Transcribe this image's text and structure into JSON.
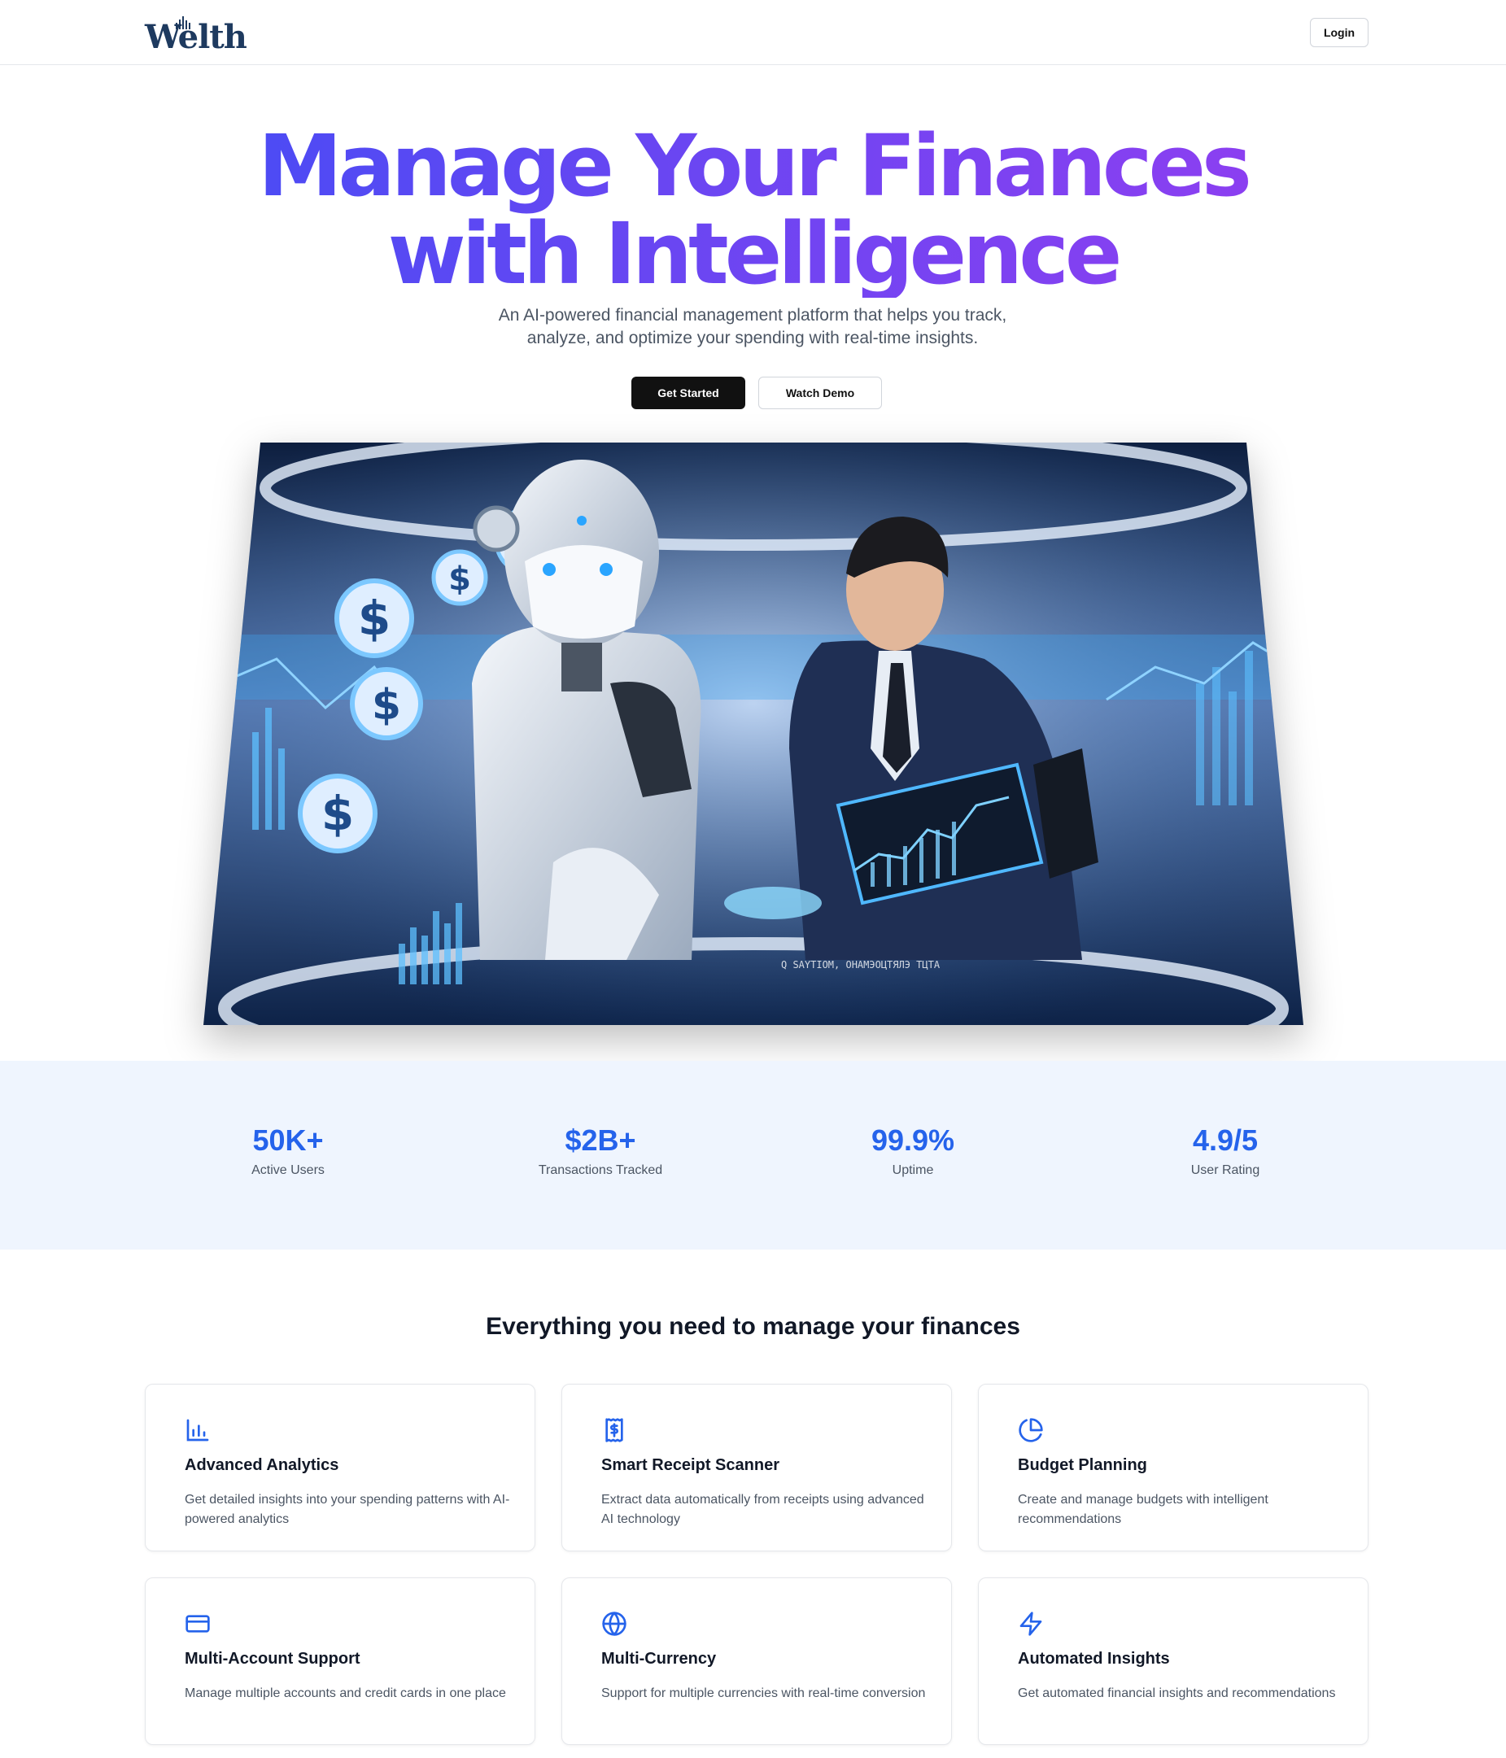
{
  "header": {
    "logo_text": "Welth",
    "login_label": "Login"
  },
  "hero": {
    "title_line1": "Manage Your Finances",
    "title_line2": "with Intelligence",
    "subtitle_line1": "An AI-powered financial management platform that helps you track,",
    "subtitle_line2": "analyze, and optimize your spending with real-time insights.",
    "primary_button": "Get Started",
    "secondary_button": "Watch Demo",
    "image_caption": "Q SAYTIOM, ОНАМЭОЦТЯЛЭ ТЦТА"
  },
  "stats": [
    {
      "value": "50K+",
      "label": "Active Users"
    },
    {
      "value": "$2B+",
      "label": "Transactions Tracked"
    },
    {
      "value": "99.9%",
      "label": "Uptime"
    },
    {
      "value": "4.9/5",
      "label": "User Rating"
    }
  ],
  "features": {
    "title": "Everything you need to manage your finances",
    "items": [
      {
        "icon": "bar-chart-icon",
        "title": "Advanced Analytics",
        "desc": "Get detailed insights into your spending patterns with AI-powered analytics"
      },
      {
        "icon": "receipt-icon",
        "title": "Smart Receipt Scanner",
        "desc": "Extract data automatically from receipts using advanced AI technology"
      },
      {
        "icon": "pie-chart-icon",
        "title": "Budget Planning",
        "desc": "Create and manage budgets with intelligent recommendations"
      },
      {
        "icon": "credit-card-icon",
        "title": "Multi-Account Support",
        "desc": "Manage multiple accounts and credit cards in one place"
      },
      {
        "icon": "globe-icon",
        "title": "Multi-Currency",
        "desc": "Support for multiple currencies with real-time conversion"
      },
      {
        "icon": "zap-icon",
        "title": "Automated Insights",
        "desc": "Get automated financial insights and recommendations"
      }
    ]
  },
  "colors": {
    "accent": "#2563eb",
    "gradient_start": "#3b4ef5",
    "gradient_end": "#9a3cf0",
    "stats_bg": "#eff5fe"
  }
}
